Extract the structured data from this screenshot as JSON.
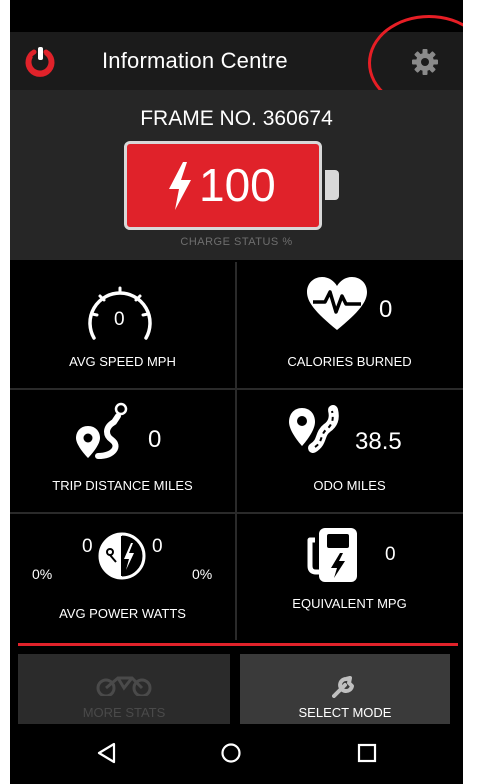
{
  "header": {
    "title": "Information Centre",
    "logo_icon": "power-logo-icon",
    "settings_icon": "gear-icon"
  },
  "battery": {
    "frame_no": "FRAME NO. 360674",
    "charge_value": "100",
    "charge_label": "CHARGE STATUS %",
    "charge_fraction": 1.0
  },
  "stats": {
    "avg_speed": {
      "value": "0",
      "label": "AVG SPEED MPH",
      "icon": "speedometer-icon"
    },
    "calories": {
      "value": "0",
      "label": "CALORIES BURNED",
      "icon": "heart-pulse-icon"
    },
    "trip_distance": {
      "value": "0",
      "label": "TRIP DISTANCE MILES",
      "icon": "route-pin-icon"
    },
    "odo": {
      "value": "38.5",
      "label": "ODO MILES",
      "icon": "odometer-route-icon"
    },
    "avg_power": {
      "label": "AVG POWER WATTS",
      "left_value": "0",
      "right_value": "0",
      "left_percent": "0%",
      "right_percent": "0%",
      "icon": "power-split-icon"
    },
    "mpg": {
      "value": "0",
      "label": "EQUIVALENT MPG",
      "icon": "charging-station-icon"
    }
  },
  "buttons": {
    "more_stats": "MORE STATS",
    "select_mode": "SELECT MODE"
  },
  "navbar": {
    "back": "back-triangle-icon",
    "home": "home-circle-icon",
    "recents": "recents-square-icon"
  },
  "colors": {
    "accent": "#e0222a",
    "background": "#000000",
    "header": "#1b1b1b"
  }
}
